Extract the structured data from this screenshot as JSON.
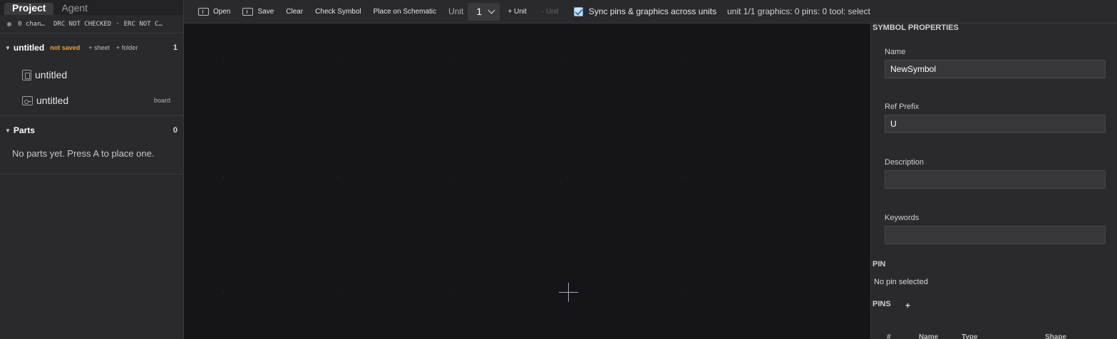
{
  "sidebar": {
    "tabs": [
      {
        "label": "Project",
        "active": true
      },
      {
        "label": "Agent",
        "active": false
      }
    ],
    "status": {
      "changes": "0 chan…",
      "drc": "DRC NOT CHECKED",
      "sep": "·",
      "erc": "ERC NOT C…"
    },
    "project": {
      "name": "untitled",
      "badge": "not saved",
      "add_sheet": "+ sheet",
      "add_folder": "+ folder",
      "count": "1",
      "files": [
        {
          "name": "untitled",
          "icon": "schematic-icon",
          "tag": ""
        },
        {
          "name": "untitled",
          "icon": "board-icon",
          "tag": "board"
        }
      ]
    },
    "parts": {
      "title": "Parts",
      "count": "0",
      "empty": "No parts yet. Press A to place one."
    }
  },
  "toolbar": {
    "open": "Open",
    "save": "Save",
    "clear": "Clear",
    "check_symbol": "Check Symbol",
    "place_on_schematic": "Place on Schematic",
    "unit_label": "Unit",
    "unit_value": "1",
    "add_unit": "+ Unit",
    "remove_unit": "- Unit",
    "sync_label": "Sync pins & graphics across units",
    "sync_checked": true,
    "status": "unit 1/1 graphics: 0 pins: 0 tool: select"
  },
  "properties": {
    "title": "SYMBOL PROPERTIES",
    "name_label": "Name",
    "name_value": "NewSymbol",
    "ref_label": "Ref Prefix",
    "ref_value": "U",
    "desc_label": "Description",
    "desc_value": "",
    "keywords_label": "Keywords",
    "keywords_value": "",
    "pin_title": "PIN",
    "no_pin": "No pin selected",
    "pins_title": "PINS",
    "add_pin": "+",
    "columns": [
      "#",
      "Name",
      "Type",
      "Shape"
    ]
  },
  "colors": {
    "accent_warning": "#e7a23a",
    "canvas_bg": "#141419",
    "panel_bg": "#2a2a2c",
    "checkbox_accent": "#2f6fc7"
  }
}
